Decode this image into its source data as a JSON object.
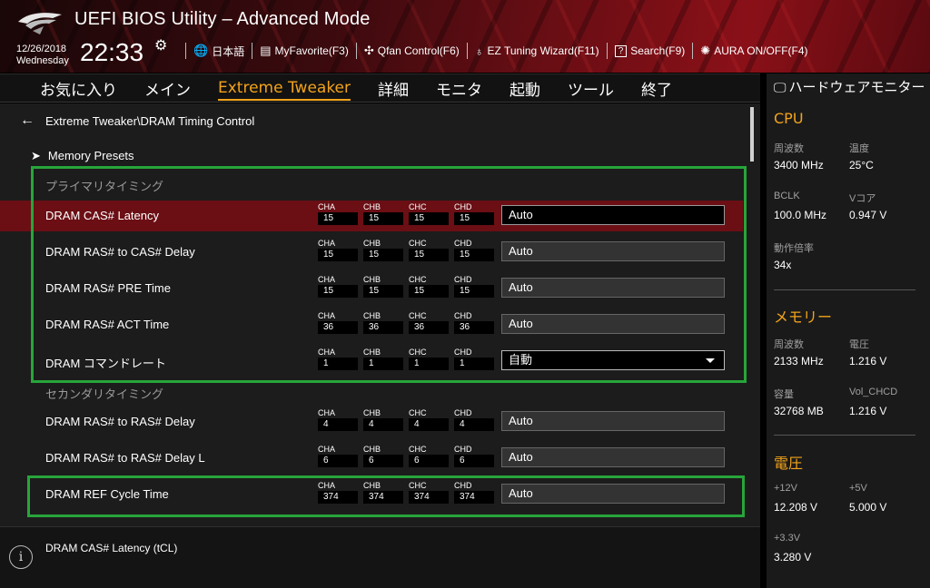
{
  "header": {
    "title": "UEFI BIOS Utility – Advanced Mode",
    "date": "12/26/2018",
    "day": "Wednesday",
    "time": "22:33",
    "toolbar": [
      {
        "icon": "globe-icon",
        "glyph": "🌐",
        "label": "日本語"
      },
      {
        "icon": "favorite-icon",
        "glyph": "▤",
        "label": "MyFavorite(F3)"
      },
      {
        "icon": "fan-icon",
        "glyph": "✣",
        "label": "Qfan Control(F6)"
      },
      {
        "icon": "bulb-icon",
        "glyph": "♁",
        "label": "EZ Tuning Wizard(F11)"
      },
      {
        "icon": "search-icon",
        "glyph": "?",
        "label": "Search(F9)"
      },
      {
        "icon": "aura-icon",
        "glyph": "✺",
        "label": "AURA ON/OFF(F4)"
      }
    ]
  },
  "nav": {
    "tabs": [
      "お気に入り",
      "メイン",
      "Extreme Tweaker",
      "詳細",
      "モニタ",
      "起動",
      "ツール",
      "終了"
    ],
    "active": "Extreme Tweaker"
  },
  "breadcrumb": "Extreme Tweaker\\DRAM Timing Control",
  "presets": "Memory Presets",
  "sections": {
    "primary": "プライマリタイミング",
    "secondary": "セカンダリタイミング"
  },
  "channels": [
    "CHA",
    "CHB",
    "CHC",
    "CHD"
  ],
  "rows": [
    {
      "label": "DRAM CAS# Latency",
      "values": [
        "15",
        "15",
        "15",
        "15"
      ],
      "setting": "Auto"
    },
    {
      "label": "DRAM RAS# to CAS# Delay",
      "values": [
        "15",
        "15",
        "15",
        "15"
      ],
      "setting": "Auto"
    },
    {
      "label": "DRAM RAS# PRE Time",
      "values": [
        "15",
        "15",
        "15",
        "15"
      ],
      "setting": "Auto"
    },
    {
      "label": "DRAM RAS# ACT Time",
      "values": [
        "36",
        "36",
        "36",
        "36"
      ],
      "setting": "Auto"
    },
    {
      "label": "DRAM コマンドレート",
      "values": [
        "1",
        "1",
        "1",
        "1"
      ],
      "setting": "自動"
    },
    {
      "label": "DRAM RAS# to RAS# Delay",
      "values": [
        "4",
        "4",
        "4",
        "4"
      ],
      "setting": "Auto"
    },
    {
      "label": "DRAM RAS# to RAS# Delay L",
      "values": [
        "6",
        "6",
        "6",
        "6"
      ],
      "setting": "Auto"
    },
    {
      "label": "DRAM REF Cycle Time",
      "values": [
        "374",
        "374",
        "374",
        "374"
      ],
      "setting": "Auto"
    }
  ],
  "help": "DRAM CAS# Latency (tCL)",
  "monitor": {
    "title": "ハードウェアモニター",
    "cpu": {
      "title": "CPU",
      "freq_label": "周波数",
      "freq": "3400 MHz",
      "temp_label": "温度",
      "temp": "25°C",
      "bclk_label": "BCLK",
      "bclk": "100.0 MHz",
      "vcore_label": "Vコア",
      "vcore": "0.947 V",
      "ratio_label": "動作倍率",
      "ratio": "34x"
    },
    "memory": {
      "title": "メモリー",
      "freq_label": "周波数",
      "freq": "2133 MHz",
      "volt_label": "電圧",
      "volt": "1.216 V",
      "cap_label": "容量",
      "cap": "32768 MB",
      "vchcd_label": "Vol_CHCD",
      "vchcd": "1.216 V"
    },
    "voltage": {
      "title": "電圧",
      "v12_label": "+12V",
      "v12": "12.208 V",
      "v5_label": "+5V",
      "v5": "5.000 V",
      "v33_label": "+3.3V",
      "v33": "3.280 V"
    }
  }
}
